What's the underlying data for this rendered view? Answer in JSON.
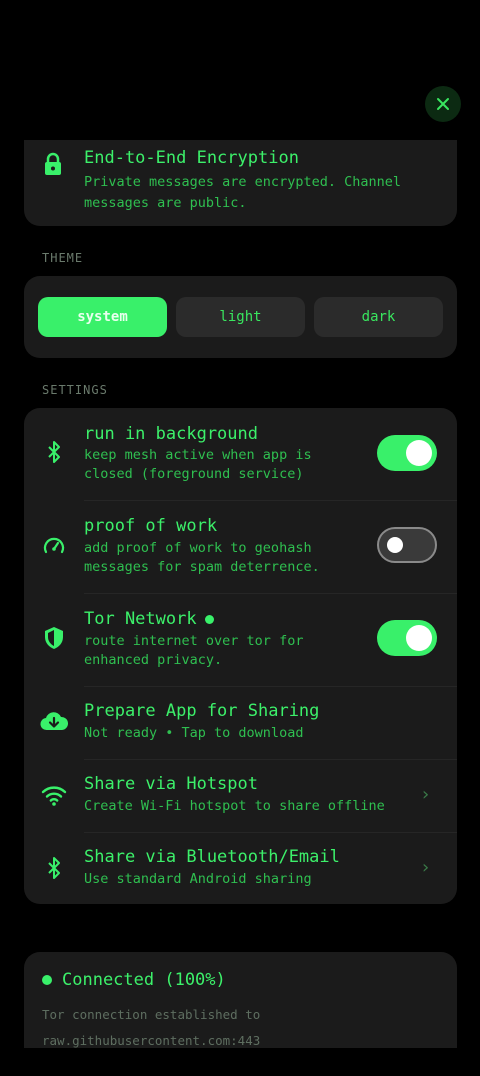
{
  "encryption": {
    "title": "End-to-End Encryption",
    "subtitle": "Private messages are encrypted. Channel messages are public."
  },
  "theme": {
    "section_label": "THEME",
    "options": [
      "system",
      "light",
      "dark"
    ],
    "selected": "system"
  },
  "settings": {
    "section_label": "SETTINGS",
    "run_in_background": {
      "title": "run in background",
      "subtitle_line1": "keep mesh active when app is",
      "subtitle_line2": "closed (foreground service)",
      "enabled": true
    },
    "proof_of_work": {
      "title": "proof of work",
      "subtitle_line1": "add proof of work to geohash",
      "subtitle_line2": "messages for spam deterrence.",
      "enabled": false
    },
    "tor_network": {
      "title": "Tor Network",
      "subtitle_line1": "route internet over tor for",
      "subtitle_line2": "enhanced privacy.",
      "enabled": true
    },
    "prepare_sharing": {
      "title": "Prepare App for Sharing",
      "subtitle": "Not ready • Tap to download"
    },
    "share_hotspot": {
      "title": "Share via Hotspot",
      "subtitle": "Create Wi-Fi hotspot to share offline"
    },
    "share_bluetooth": {
      "title": "Share via Bluetooth/Email",
      "subtitle": "Use standard Android sharing"
    }
  },
  "status": {
    "title": "Connected (100%)",
    "line1": "Tor connection established to",
    "line2": "raw.githubusercontent.com:443"
  },
  "colors": {
    "accent": "#39f06a",
    "background": "#000000",
    "card": "#1b1b1b"
  },
  "icons": {
    "close": "close-icon",
    "lock": "lock-icon",
    "bluetooth": "bluetooth-icon",
    "speedometer": "speedometer-icon",
    "shield": "shield-icon",
    "cloud_download": "cloud-download-icon",
    "wifi": "wifi-icon",
    "chevron": "chevron-right-icon"
  }
}
